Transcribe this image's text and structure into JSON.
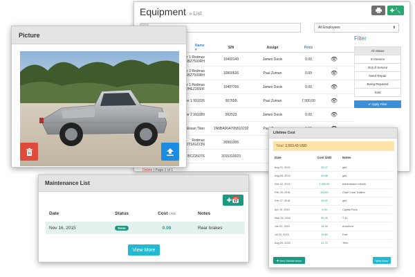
{
  "equipment": {
    "title": "Equipment",
    "subtitle": "» List",
    "print_icon": "print-icon",
    "add_icon": "plus-wrench-icon",
    "search_placeholder": "Search items",
    "employee_select": "All Employees",
    "columns": {
      "name": "Name ▾",
      "sn": "S/N",
      "assign": "Assign",
      "price": "Price"
    },
    "rows": [
      {
        "name": "Mower 1 Redmax EBZ7500RH",
        "sn": "10400143",
        "assign": "James Davis",
        "price": "0.00"
      },
      {
        "name": "Mower 2 Redmax EBZ7500RH",
        "sn": "10800636",
        "assign": "Paul Zuman",
        "price": "0.00"
      },
      {
        "name": "Mower 1 Redmax GZ25N/HEZ2650F",
        "sn": "10407766",
        "assign": "James Davis",
        "price": "0.00"
      },
      {
        "name": "Gravely Mower 1 991026",
        "sn": "007658",
        "assign": "Paul Zuman",
        "price": "7,500.00"
      },
      {
        "name": "Mower 2 991089",
        "sn": "002523",
        "assign": "James Davis",
        "price": "0.00"
      },
      {
        "name": "Nissan Titan",
        "sn": "1N6BA06A76N510232",
        "assign": "Paul Zuman",
        "price": "0.00"
      },
      {
        "name": "Redmax BCZ2460TS/GZ23N",
        "sn": "30901006",
        "assign": "",
        "price": ""
      },
      {
        "name": "RedMax 1 BCZ260TS",
        "sn": "2015310023",
        "assign": "",
        "price": ""
      }
    ],
    "pager_deleted": "Delete",
    "pager_text": "Page 1 of 1",
    "filter": {
      "title": "Filter",
      "items": [
        "All Status",
        "In Service",
        "Out of Service",
        "Need Repair",
        "Being Repaired",
        "Sold"
      ],
      "apply_label": "✔ Apply Filter"
    }
  },
  "picture": {
    "title": "Picture"
  },
  "maintenance": {
    "title": "Maintenance List",
    "columns": {
      "date": "Date",
      "status": "Status",
      "cost": "Cost",
      "cost_unit": "USD",
      "notes": "Notes"
    },
    "rows": [
      {
        "date": "Nov 16, 2015",
        "status": "Done",
        "cost": "0.00",
        "notes": "Rear brakes"
      }
    ],
    "view_more": "View More"
  },
  "lifetime": {
    "title": "Lifetime Cost",
    "total_label": "Total:",
    "total_value": "2,553.43 USD",
    "columns": {
      "date": "Date",
      "cost": "Cost USD",
      "notes": "Notes"
    },
    "rows": [
      {
        "date": "Aug 21, 2014",
        "cost": "28.27",
        "notes": "gas"
      },
      {
        "date": "Aug 28, 2014",
        "cost": "69.68",
        "notes": "gas"
      },
      {
        "date": "Dec 22, 2014",
        "cost": "1,469.00",
        "notes": "transmission rebuild"
      },
      {
        "date": "Feb 25, 2015",
        "cost": "411.63",
        "notes": "Cape Coral Trailers"
      },
      {
        "date": "Feb 27, 2015",
        "cost": "20.00",
        "notes": "gas"
      },
      {
        "date": "Apr 10, 2015",
        "cost": "9.99",
        "notes": "Capital Parts"
      },
      {
        "date": "May 28, 2015",
        "cost": "89.36",
        "notes": "7-11"
      },
      {
        "date": "Jun 22, 2015",
        "cost": "18.38",
        "notes": "AutoZone"
      },
      {
        "date": "Jul 20, 2015",
        "cost": "19.80",
        "notes": "Fuel"
      },
      {
        "date": "Aug 29, 2015",
        "cost": "41.70",
        "notes": "Tires"
      }
    ],
    "new_maintenance": "✚ New Maintenance",
    "view_more": "View More"
  }
}
